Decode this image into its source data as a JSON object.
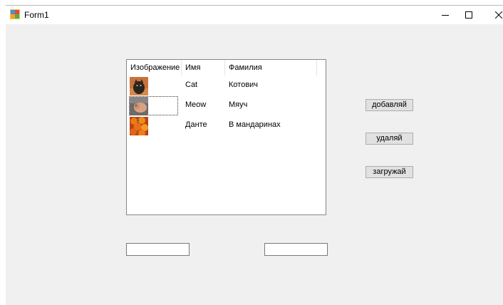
{
  "window": {
    "title": "Form1",
    "icon": "form-app-icon",
    "controls": [
      "minimize-icon",
      "maximize-icon",
      "close-icon"
    ]
  },
  "listview": {
    "columns": [
      "Изображение",
      "Имя",
      "Фамилия"
    ],
    "rows": [
      {
        "image": "cat-photo",
        "first": "Cat",
        "last": "Котович"
      },
      {
        "image": "cat-photo-2",
        "first": "Meow",
        "last": "Мяуч"
      },
      {
        "image": "tangerines-photo",
        "first": "Данте",
        "last": "В мандаринах"
      }
    ],
    "focused_row": 1
  },
  "buttons": {
    "add": "добавляй",
    "delete": "удаляй",
    "load": "загружай"
  },
  "inputs": {
    "left": {
      "value": "",
      "placeholder": ""
    },
    "right": {
      "value": "",
      "placeholder": ""
    }
  },
  "colors": {
    "client_bg": "#f0f0f0",
    "button_bg": "#e1e1e1",
    "button_border": "#adadad"
  }
}
